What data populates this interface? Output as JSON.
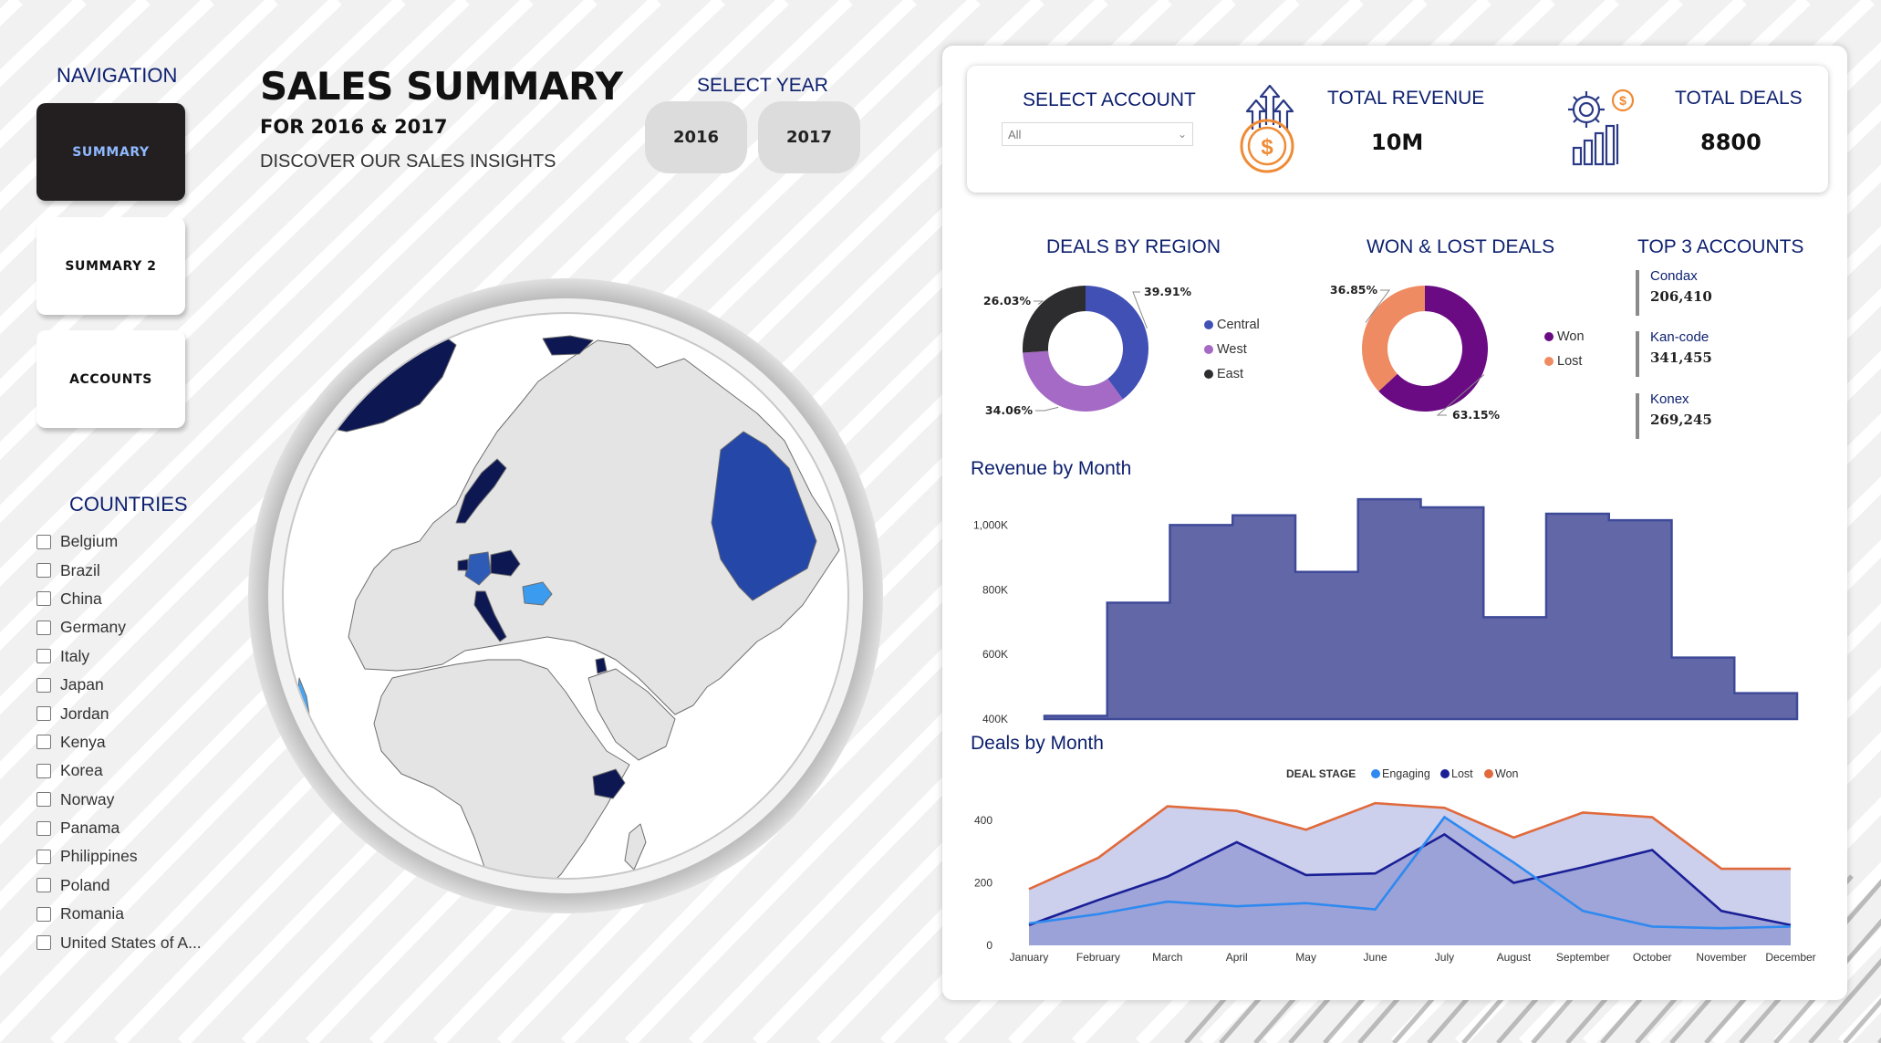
{
  "nav": {
    "title": "NAVIGATION",
    "buttons": [
      "SUMMARY",
      "SUMMARY 2",
      "ACCOUNTS"
    ],
    "active": "SUMMARY"
  },
  "header": {
    "title": "SALES SUMMARY",
    "subtitle": "FOR 2016 & 2017",
    "tagline": "DISCOVER OUR SALES INSIGHTS"
  },
  "year_filter": {
    "title": "SELECT YEAR",
    "options": [
      "2016",
      "2017"
    ]
  },
  "countries": {
    "title": "COUNTRIES",
    "items": [
      "Belgium",
      "Brazil",
      "China",
      "Germany",
      "Italy",
      "Japan",
      "Jordan",
      "Kenya",
      "Korea",
      "Norway",
      "Panama",
      "Philippines",
      "Poland",
      "Romania",
      "United States of A..."
    ]
  },
  "kpis": {
    "account": {
      "label": "SELECT ACCOUNT",
      "value": "All"
    },
    "revenue": {
      "label": "TOTAL REVENUE",
      "value": "10M"
    },
    "deals": {
      "label": "TOTAL DEALS",
      "value": "8800"
    }
  },
  "top_accounts": {
    "title": "TOP 3 ACCOUNTS",
    "items": [
      {
        "name": "Condax",
        "value": "206,410"
      },
      {
        "name": "Kan-code",
        "value": "341,455"
      },
      {
        "name": "Konex",
        "value": "269,245"
      }
    ]
  },
  "colors": {
    "navy": "#0c1f6e",
    "central": "#4150b5",
    "west": "#a46ac5",
    "east": "#2d2d2f",
    "won": "#6a0b84",
    "lost": "#ef8b62",
    "revenue_fill": "#6267a8",
    "revenue_line": "#3f4a98",
    "engaging": "#2e89f0",
    "lost_line": "#1a1f96",
    "won_line": "#e06a3c"
  },
  "chart_data": [
    {
      "type": "pie",
      "title": "DEALS BY REGION",
      "labels": [
        "Central",
        "West",
        "East"
      ],
      "values": [
        39.91,
        34.06,
        26.03
      ],
      "value_labels": [
        "39.91%",
        "34.06%",
        "26.03%"
      ],
      "legend": "right"
    },
    {
      "type": "pie",
      "title": "WON & LOST DEALS",
      "labels": [
        "Won",
        "Lost"
      ],
      "values": [
        63.15,
        36.85
      ],
      "value_labels": [
        "63.15%",
        "36.85%"
      ],
      "legend": "right"
    },
    {
      "type": "area",
      "title": "Revenue by Month",
      "categories": [
        "January",
        "February",
        "March",
        "April",
        "May",
        "June",
        "July",
        "August",
        "September",
        "October",
        "November",
        "December"
      ],
      "values": [
        410000,
        760000,
        1000000,
        1030000,
        855000,
        1080000,
        1055000,
        715000,
        1035000,
        1015000,
        590000,
        480000
      ],
      "ylim": [
        400000,
        1100000
      ],
      "yticks": [
        400000,
        600000,
        800000,
        1000000
      ],
      "ytick_labels": [
        "400K",
        "600K",
        "800K",
        "1,000K"
      ]
    },
    {
      "type": "area",
      "title": "Deals by Month",
      "legend_title": "DEAL STAGE",
      "categories": [
        "January",
        "February",
        "March",
        "April",
        "May",
        "June",
        "July",
        "August",
        "September",
        "October",
        "November",
        "December"
      ],
      "series": [
        {
          "name": "Engaging",
          "values": [
            70,
            100,
            140,
            125,
            135,
            115,
            410,
            265,
            110,
            60,
            55,
            60
          ]
        },
        {
          "name": "Lost",
          "values": [
            65,
            145,
            220,
            330,
            225,
            230,
            355,
            200,
            250,
            305,
            110,
            65
          ]
        },
        {
          "name": "Won",
          "values": [
            180,
            280,
            445,
            430,
            370,
            455,
            440,
            345,
            425,
            410,
            245,
            245
          ]
        }
      ],
      "ylim": [
        0,
        470
      ],
      "yticks": [
        0,
        200,
        400
      ],
      "legend": "top"
    }
  ]
}
